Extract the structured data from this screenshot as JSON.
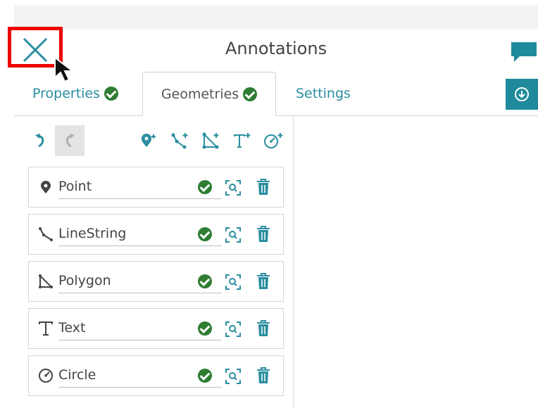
{
  "header": {
    "title": "Annotations"
  },
  "tabs": [
    {
      "label": "Properties",
      "valid": true
    },
    {
      "label": "Geometries",
      "valid": true,
      "active": true
    },
    {
      "label": "Settings"
    }
  ],
  "toolbar": {
    "icons": [
      "undo-icon",
      "redo-icon",
      "add-point-icon",
      "add-linestring-icon",
      "add-polygon-icon",
      "add-text-icon",
      "add-circle-icon"
    ]
  },
  "geometries": [
    {
      "name": "Point",
      "icon": "point-icon"
    },
    {
      "name": "LineString",
      "icon": "linestring-icon"
    },
    {
      "name": "Polygon",
      "icon": "polygon-icon"
    },
    {
      "name": "Text",
      "icon": "text-icon"
    },
    {
      "name": "Circle",
      "icon": "circle-icon"
    }
  ],
  "colors": {
    "accent": "#2a8ea0",
    "ok": "#2e7d32",
    "highlight": "#ee0000"
  }
}
